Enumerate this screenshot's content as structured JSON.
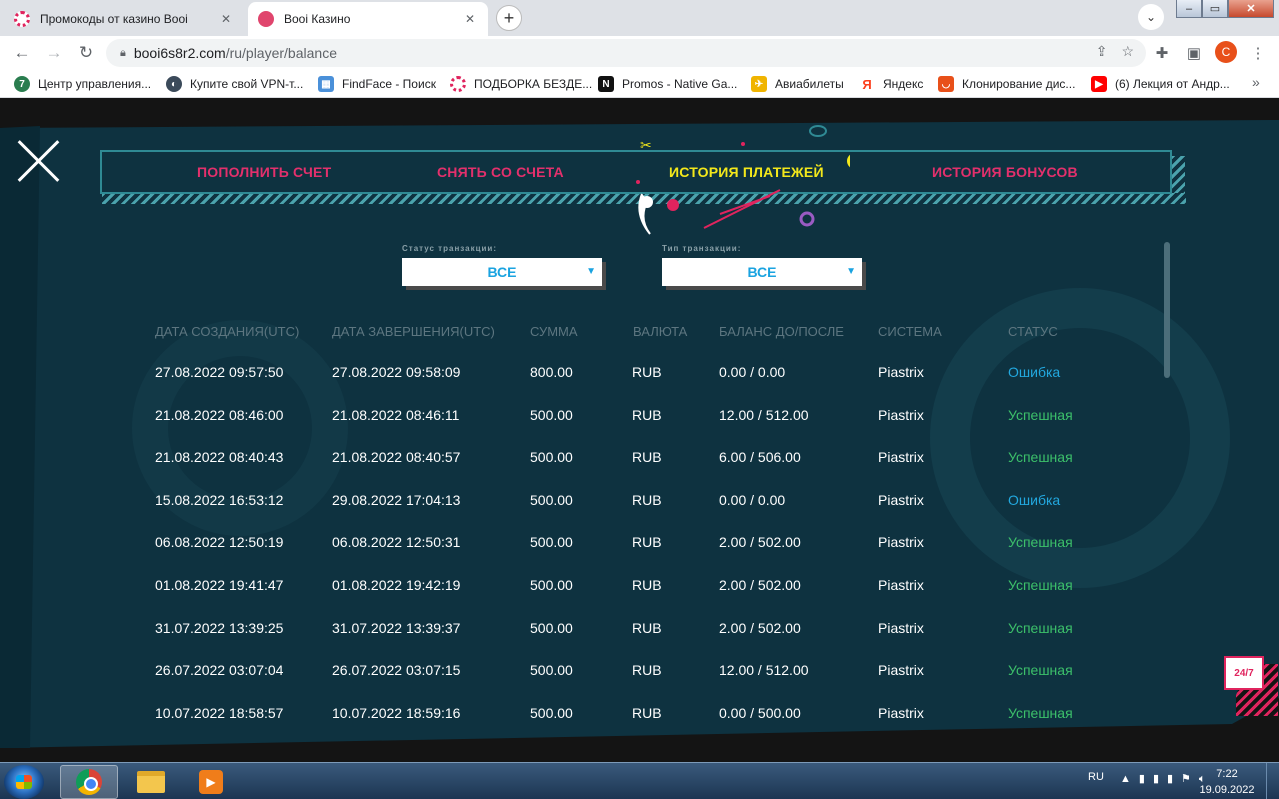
{
  "browser": {
    "tabs": [
      {
        "title": "Промокоды от казино Booi",
        "active": false
      },
      {
        "title": "Booi Казино",
        "active": true
      }
    ],
    "url_host": "booi6s8r2.com",
    "url_path": "/ru/player/balance",
    "profile_initial": "C",
    "bookmarks": [
      "Центр управления...",
      "Купите свой VPN-т...",
      "FindFace - Поиск",
      "ПОДБОРКА БЕЗДЕ...",
      "Promos - Native Ga...",
      "Авиабилеты",
      "Яндекс",
      "Клонирование дис...",
      "(6) Лекция от Андр..."
    ]
  },
  "page": {
    "tabs": [
      {
        "label": "ПОПОЛНИТЬ СЧЕТ",
        "active": false
      },
      {
        "label": "СНЯТЬ СО СЧЕТА",
        "active": false
      },
      {
        "label": "ИСТОРИЯ ПЛАТЕЖЕЙ",
        "active": true
      },
      {
        "label": "ИСТОРИЯ БОНУСОВ",
        "active": false
      }
    ],
    "filters": {
      "status_label": "Статус транзакции:",
      "status_value": "ВСЕ",
      "type_label": "Тип транзакции:",
      "type_value": "ВСЕ"
    },
    "table": {
      "headers": [
        "ДАТА СОЗДАНИЯ(UTC)",
        "ДАТА ЗАВЕРШЕНИЯ(UTC)",
        "СУММА",
        "ВАЛЮТА",
        "БАЛАНС ДО/ПОСЛЕ",
        "СИСТЕМА",
        "СТАТУС"
      ],
      "rows": [
        [
          "27.08.2022 09:57:50",
          "27.08.2022 09:58:09",
          "800.00",
          "RUB",
          "0.00 / 0.00",
          "Piastrix",
          "Ошибка"
        ],
        [
          "21.08.2022 08:46:00",
          "21.08.2022 08:46:11",
          "500.00",
          "RUB",
          "12.00 / 512.00",
          "Piastrix",
          "Успешная"
        ],
        [
          "21.08.2022 08:40:43",
          "21.08.2022 08:40:57",
          "500.00",
          "RUB",
          "6.00 / 506.00",
          "Piastrix",
          "Успешная"
        ],
        [
          "15.08.2022 16:53:12",
          "29.08.2022 17:04:13",
          "500.00",
          "RUB",
          "0.00 / 0.00",
          "Piastrix",
          "Ошибка"
        ],
        [
          "06.08.2022 12:50:19",
          "06.08.2022 12:50:31",
          "500.00",
          "RUB",
          "2.00 / 502.00",
          "Piastrix",
          "Успешная"
        ],
        [
          "01.08.2022 19:41:47",
          "01.08.2022 19:42:19",
          "500.00",
          "RUB",
          "2.00 / 502.00",
          "Piastrix",
          "Успешная"
        ],
        [
          "31.07.2022 13:39:25",
          "31.07.2022 13:39:37",
          "500.00",
          "RUB",
          "2.00 / 502.00",
          "Piastrix",
          "Успешная"
        ],
        [
          "26.07.2022 03:07:04",
          "26.07.2022 03:07:15",
          "500.00",
          "RUB",
          "12.00 / 512.00",
          "Piastrix",
          "Успешная"
        ],
        [
          "10.07.2022 18:58:57",
          "10.07.2022 18:59:16",
          "500.00",
          "RUB",
          "0.00 / 500.00",
          "Piastrix",
          "Успешная"
        ]
      ]
    },
    "support_label": "24/7"
  },
  "taskbar": {
    "language": "RU",
    "time": "7:22",
    "date": "19.09.2022"
  },
  "colors": {
    "tab_inactive": "#e3306c",
    "tab_active": "#f3e81b",
    "status_error": "#22a8df",
    "status_success": "#3cc06a",
    "panel": "#0e3240"
  },
  "icons": [
    "close-icon",
    "back-icon",
    "forward-icon",
    "reload-icon",
    "lock-icon",
    "share-icon",
    "star-icon",
    "extensions-icon",
    "sidepanel-icon",
    "menu-icon",
    "dropdown-arrow-icon",
    "windows-start-icon",
    "chrome-icon",
    "folder-icon",
    "media-player-icon"
  ]
}
